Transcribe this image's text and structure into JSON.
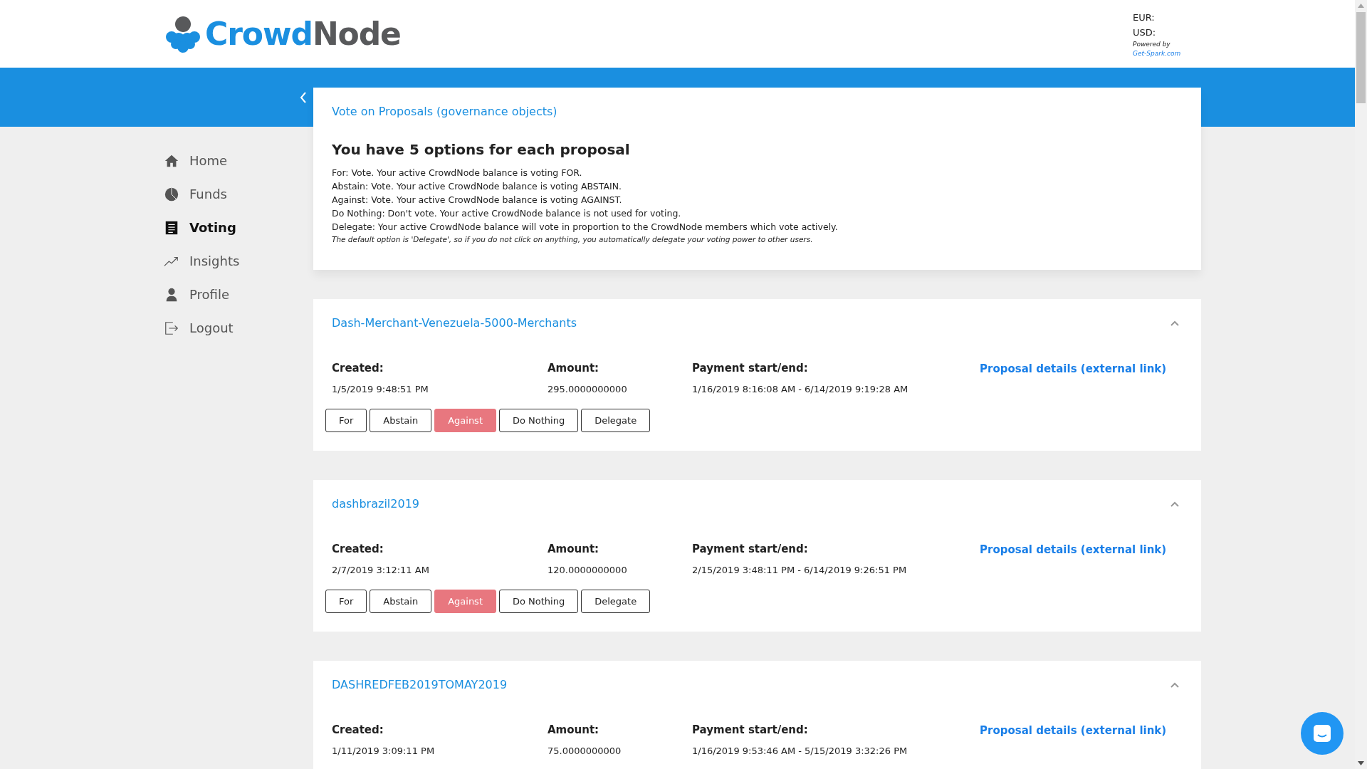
{
  "logo": {
    "first": "Crowd",
    "second": "Node"
  },
  "prices": {
    "eur": "EUR:",
    "usd": "USD:",
    "powered_by": "Powered by",
    "powered_link": "Get-Spark.com"
  },
  "sidebar": {
    "items": [
      {
        "label": "Home",
        "selected": false
      },
      {
        "label": "Funds",
        "selected": false
      },
      {
        "label": "Voting",
        "selected": true
      },
      {
        "label": "Insights",
        "selected": false
      },
      {
        "label": "Profile",
        "selected": false
      },
      {
        "label": "Logout",
        "selected": false
      }
    ]
  },
  "info": {
    "title": "Vote on Proposals (governance objects)",
    "heading": "You have 5 options for each proposal",
    "lines": [
      "For: Vote. Your active CrowdNode balance is voting FOR.",
      "Abstain: Vote. Your active CrowdNode balance is voting ABSTAIN.",
      "Against: Vote. Your active CrowdNode balance is voting AGAINST.",
      "Do Nothing: Don't vote. Your active CrowdNode balance is not used for voting.",
      "Delegate: Your active CrowdNode balance will vote in proportion to the CrowdNode members which vote actively."
    ],
    "note": "The default option is 'Delegate', so if you do not click on anything, you automatically delegate your voting power to other users."
  },
  "proposals": [
    {
      "name": "Dash-Merchant-Venezuela-5000-Merchants",
      "expanded": true,
      "created_label": "Created:",
      "created": "1/5/2019 9:48:51 PM",
      "amount_label": "Amount:",
      "amount": "295.0000000000",
      "payment_label": "Payment start/end:",
      "payment": "1/16/2019 8:16:08 AM - 6/14/2019 9:19:28 AM",
      "link": "Proposal details (external link)",
      "votes": [
        {
          "label": "For",
          "selected": false
        },
        {
          "label": "Abstain",
          "selected": false
        },
        {
          "label": "Against",
          "selected": true
        },
        {
          "label": "Do Nothing",
          "selected": false
        },
        {
          "label": "Delegate",
          "selected": false
        }
      ]
    },
    {
      "name": "dashbrazil2019",
      "expanded": true,
      "created_label": "Created:",
      "created": "2/7/2019 3:12:11 AM",
      "amount_label": "Amount:",
      "amount": "120.0000000000",
      "payment_label": "Payment start/end:",
      "payment": "2/15/2019 3:48:11 PM - 6/14/2019 9:26:51 PM",
      "link": "Proposal details (external link)",
      "votes": [
        {
          "label": "For",
          "selected": false
        },
        {
          "label": "Abstain",
          "selected": false
        },
        {
          "label": "Against",
          "selected": true
        },
        {
          "label": "Do Nothing",
          "selected": false
        },
        {
          "label": "Delegate",
          "selected": false
        }
      ]
    },
    {
      "name": "DASHREDFEB2019TOMAY2019",
      "expanded": true,
      "created_label": "Created:",
      "created": "1/11/2019 3:09:11 PM",
      "amount_label": "Amount:",
      "amount": "75.0000000000",
      "payment_label": "Payment start/end:",
      "payment": "1/16/2019 9:53:46 AM - 5/15/2019 3:32:26 PM",
      "link": "Proposal details (external link)"
    }
  ]
}
